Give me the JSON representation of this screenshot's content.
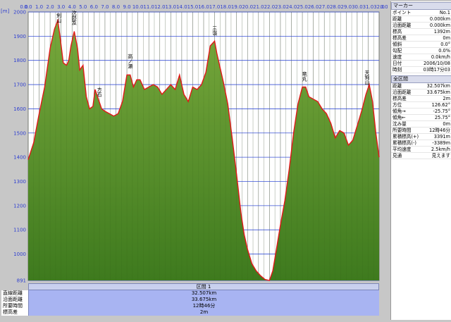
{
  "unit_label": "[m]",
  "chart_data": {
    "type": "area",
    "title": "",
    "xlabel": "",
    "ylabel": "[m]",
    "xlim": [
      0,
      32.0
    ],
    "ylim": [
      891,
      2000
    ],
    "y_ticks": [
      "2000",
      "1900",
      "1800",
      "1700",
      "1600",
      "1500",
      "1400",
      "1300",
      "1200",
      "1100",
      "1000",
      "891"
    ],
    "y_tick_values": [
      2000,
      1900,
      1800,
      1700,
      1600,
      1500,
      1400,
      1300,
      1200,
      1100,
      1000,
      891
    ],
    "x_ticks": [
      "0.0",
      "0.0",
      "1.0",
      "2.0",
      "3.0",
      "4.0",
      "5.0",
      "6.0",
      "7.0",
      "8.0",
      "9.0",
      "10.0",
      "11.0",
      "12.0",
      "13.0",
      "14.0",
      "15.0",
      "16.0",
      "17.0",
      "18.0",
      "19.0",
      "20.0",
      "21.0",
      "22.0",
      "23.0",
      "24.0",
      "25.0",
      "26.0",
      "27.0",
      "28.0",
      "29.0",
      "30.0",
      "31.0",
      "32.0",
      "0.0"
    ],
    "fill_color": "#78a83c",
    "line_color": "#e21818",
    "x": [
      0,
      0.5,
      1.0,
      1.5,
      2.0,
      2.4,
      2.7,
      2.9,
      3.2,
      3.5,
      3.7,
      3.9,
      4.2,
      4.5,
      4.7,
      5.0,
      5.3,
      5.6,
      5.9,
      6.1,
      6.4,
      6.7,
      7.0,
      7.4,
      7.8,
      8.2,
      8.6,
      9.0,
      9.3,
      9.6,
      9.9,
      10.2,
      10.6,
      11.0,
      11.4,
      11.8,
      12.2,
      12.6,
      13.0,
      13.4,
      13.8,
      14.2,
      14.6,
      15.0,
      15.4,
      15.8,
      16.2,
      16.6,
      17.0,
      17.2,
      17.5,
      17.8,
      18.2,
      18.6,
      19.0,
      19.4,
      19.7,
      20.0,
      20.4,
      20.8,
      21.2,
      21.6,
      22.0,
      22.3,
      22.6,
      23.0,
      23.4,
      23.8,
      24.2,
      24.6,
      25.0,
      25.3,
      25.6,
      26.0,
      26.4,
      26.8,
      27.2,
      27.6,
      28.0,
      28.4,
      28.8,
      29.2,
      29.6,
      30.0,
      30.4,
      30.8,
      31.1,
      31.4,
      31.7,
      32.0
    ],
    "y": [
      1390,
      1460,
      1580,
      1690,
      1850,
      1930,
      1965,
      1900,
      1790,
      1780,
      1800,
      1860,
      1920,
      1850,
      1760,
      1780,
      1650,
      1600,
      1610,
      1680,
      1640,
      1600,
      1590,
      1580,
      1570,
      1580,
      1630,
      1740,
      1740,
      1690,
      1720,
      1720,
      1680,
      1690,
      1700,
      1690,
      1660,
      1680,
      1700,
      1680,
      1740,
      1660,
      1630,
      1690,
      1680,
      1700,
      1750,
      1860,
      1880,
      1830,
      1770,
      1710,
      1620,
      1480,
      1330,
      1170,
      1080,
      1020,
      960,
      930,
      910,
      895,
      891,
      930,
      1010,
      1120,
      1220,
      1350,
      1500,
      1620,
      1690,
      1690,
      1650,
      1640,
      1630,
      1600,
      1580,
      1540,
      1480,
      1510,
      1500,
      1450,
      1470,
      1530,
      1590,
      1660,
      1700,
      1630,
      1500,
      1400
    ],
    "annotations": [
      {
        "text": "剣山",
        "x": 2.8
      },
      {
        "text": "次郎笈",
        "x": 4.2
      },
      {
        "text": "方石",
        "x": 6.5
      },
      {
        "text": "高ノ瀬",
        "x": 9.3
      },
      {
        "text": "三嶺",
        "x": 17.0
      },
      {
        "text": "竜丸",
        "x": 25.2
      },
      {
        "text": "天狗山",
        "x": 30.9
      }
    ]
  },
  "panel": {
    "marker": {
      "header": "マーカー",
      "rows": [
        {
          "label": "ポイント",
          "value": "No.1"
        },
        {
          "label": "距離",
          "value": "0.000km"
        },
        {
          "label": "沿面距離",
          "value": "0.000km"
        },
        {
          "label": "標高",
          "value": "1392m"
        },
        {
          "label": "標高差",
          "value": "0m"
        },
        {
          "label": "傾斜",
          "value": "0.0°"
        },
        {
          "label": "勾配",
          "value": "0.0%"
        },
        {
          "label": "速度",
          "value": "0.0km/h"
        },
        {
          "label": "日付",
          "value": "2006/10/08"
        },
        {
          "label": "時刻",
          "value": "03時17分03"
        }
      ]
    },
    "section": {
      "header": "全区間",
      "rows": [
        {
          "label": "距離",
          "value": "32.507km"
        },
        {
          "label": "沿面距離",
          "value": "33.675km"
        },
        {
          "label": "標高差",
          "value": "2m"
        },
        {
          "label": "方位",
          "value": "126.62°"
        },
        {
          "label": "傾角→",
          "value": "-25.75°"
        },
        {
          "label": "傾角←",
          "value": "25.75°"
        },
        {
          "label": "沈み量",
          "value": "0m"
        },
        {
          "label": "所要時間",
          "value": "12時46分"
        },
        {
          "label": "累積標高(+)",
          "value": "3391m"
        },
        {
          "label": "累積標高(-)",
          "value": "-3389m"
        },
        {
          "label": "平均速度",
          "value": "2.5km/h"
        },
        {
          "label": "見通",
          "value": "見えます"
        }
      ]
    }
  },
  "bottom": {
    "title": "区間 1",
    "rows": [
      {
        "label": "直線距離",
        "value": "32.507km"
      },
      {
        "label": "沿面距離",
        "value": "33.675km"
      },
      {
        "label": "所要時間",
        "value": "12時46分"
      },
      {
        "label": "標高差",
        "value": "2m"
      }
    ]
  }
}
